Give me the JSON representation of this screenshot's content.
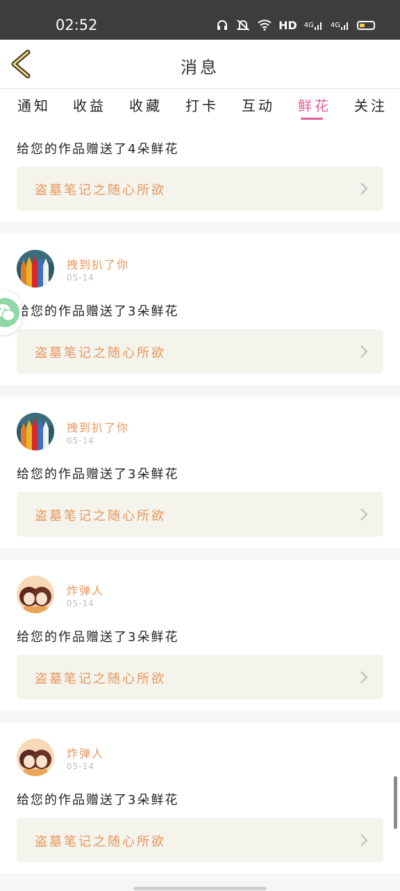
{
  "status_bar": {
    "time": "02:52",
    "hd_label": "HD",
    "network_1": "4G",
    "network_2": "4G"
  },
  "header": {
    "title": "消息"
  },
  "tabs": [
    {
      "label": "通知"
    },
    {
      "label": "收益"
    },
    {
      "label": "收藏"
    },
    {
      "label": "打卡"
    },
    {
      "label": "互动"
    },
    {
      "label": "鲜花",
      "active": true
    },
    {
      "label": "关注"
    }
  ],
  "feed": [
    {
      "message": "给您的作品赠送了4朵鲜花",
      "work_title": "盗墓笔记之随心所欲"
    },
    {
      "user": "拽到扒了你",
      "date": "05-14",
      "message": "给您的作品赠送了3朵鲜花",
      "work_title": "盗墓笔记之随心所欲",
      "avatar": "pencils"
    },
    {
      "user": "拽到扒了你",
      "date": "05-14",
      "message": "给您的作品赠送了3朵鲜花",
      "work_title": "盗墓笔记之随心所欲",
      "avatar": "pencils"
    },
    {
      "user": "炸弹人",
      "date": "05-14",
      "message": "给您的作品赠送了3朵鲜花",
      "work_title": "盗墓笔记之随心所欲",
      "avatar": "anime-girls"
    },
    {
      "user": "炸弹人",
      "date": "05-14",
      "message": "给您的作品赠送了3朵鲜花",
      "work_title": "盗墓笔记之随心所欲",
      "avatar": "anime-girls"
    }
  ],
  "colors": {
    "accent_pink": "#e55b96",
    "accent_orange": "#e8965c",
    "wechat_green": "#8fd8a6"
  },
  "icons": {
    "back": "back-chevron-icon",
    "wechat": "wechat-icon",
    "row_chevron": "chevron-right-icon"
  }
}
